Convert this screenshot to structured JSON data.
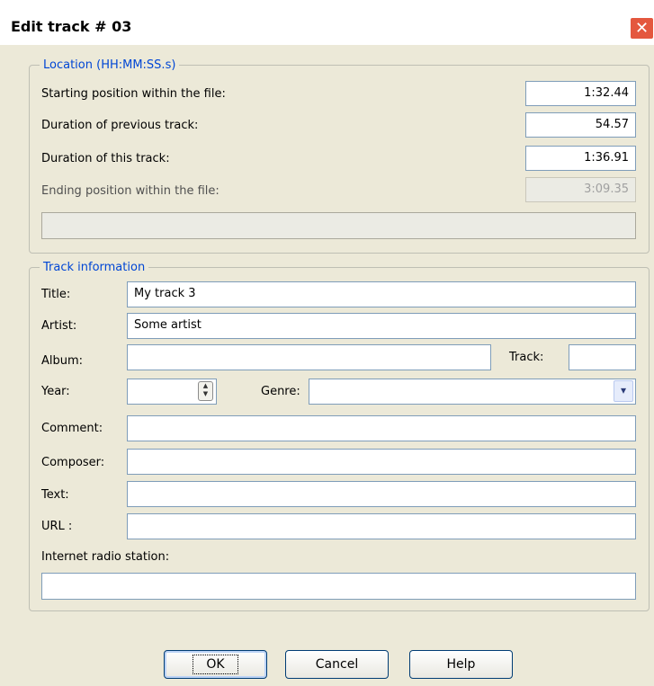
{
  "window": {
    "title": "Edit track # 03",
    "close_glyph": "✕"
  },
  "location": {
    "legend": "Location (HH:MM:SS.s)",
    "starting_label": "Starting position within the file:",
    "starting_value": "1:32.44",
    "prev_label": "Duration of previous track:",
    "prev_value": "54.57",
    "this_label": "Duration of this track:",
    "this_value": "1:36.91",
    "ending_label": "Ending position within the file:",
    "ending_value": "3:09.35"
  },
  "track_info": {
    "legend": "Track information",
    "title_label": "Title:",
    "title_value": "My track 3",
    "artist_label": "Artist:",
    "artist_value": "Some artist",
    "album_label": "Album:",
    "album_value": "",
    "track_label": "Track:",
    "track_value": "",
    "year_label": "Year:",
    "year_value": "",
    "genre_label": "Genre:",
    "genre_value": "",
    "comment_label": "Comment:",
    "comment_value": "",
    "composer_label": "Composer:",
    "composer_value": "",
    "text_label": "Text:",
    "text_value": "",
    "url_label": "URL :",
    "url_value": "",
    "radio_label": "Internet radio station:",
    "radio_value": ""
  },
  "buttons": {
    "ok": "OK",
    "cancel": "Cancel",
    "help": "Help"
  },
  "icons": {
    "close": "close-icon",
    "spin": "spinner-arrows-icon",
    "dropdown": "chevron-down-icon"
  }
}
